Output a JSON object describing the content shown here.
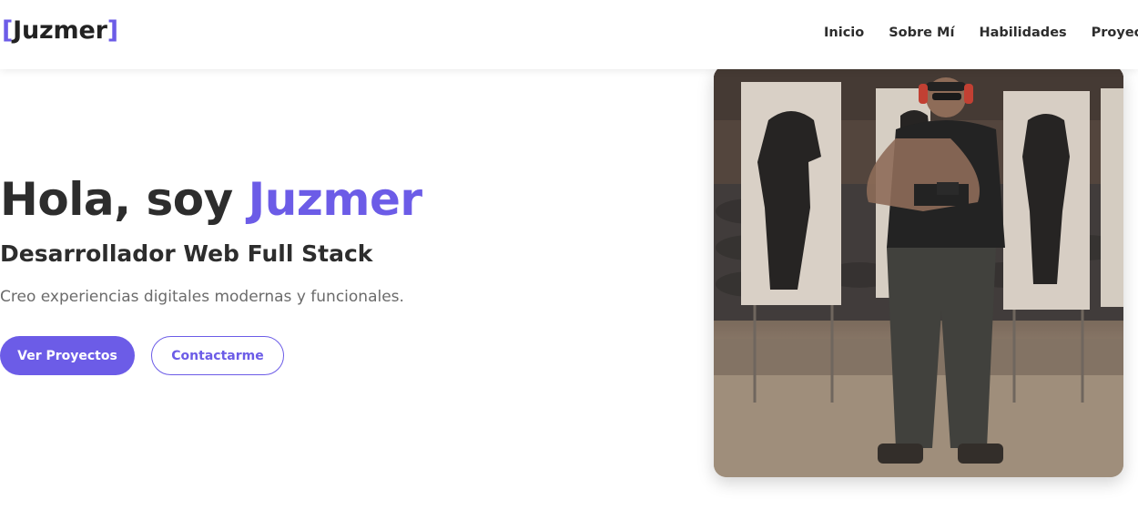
{
  "header": {
    "logo": {
      "open": "[",
      "name": "Juzmer",
      "close": "]"
    },
    "nav": [
      "Inicio",
      "Sobre Mí",
      "Habilidades",
      "Proyectos"
    ]
  },
  "hero": {
    "title_prefix": "Hola, soy ",
    "title_name": "Juzmer",
    "subtitle": "Desarrollador Web Full Stack",
    "description": "Creo experiencias digitales modernas y funcionales.",
    "primary_button": "Ver Proyectos",
    "secondary_button": "Contactarme"
  },
  "photo": {
    "alt": "Foto de perfil en campo de tiro"
  },
  "colors": {
    "accent": "#6c5ce7",
    "text": "#2d2d2d",
    "muted": "#6b6b6b"
  }
}
